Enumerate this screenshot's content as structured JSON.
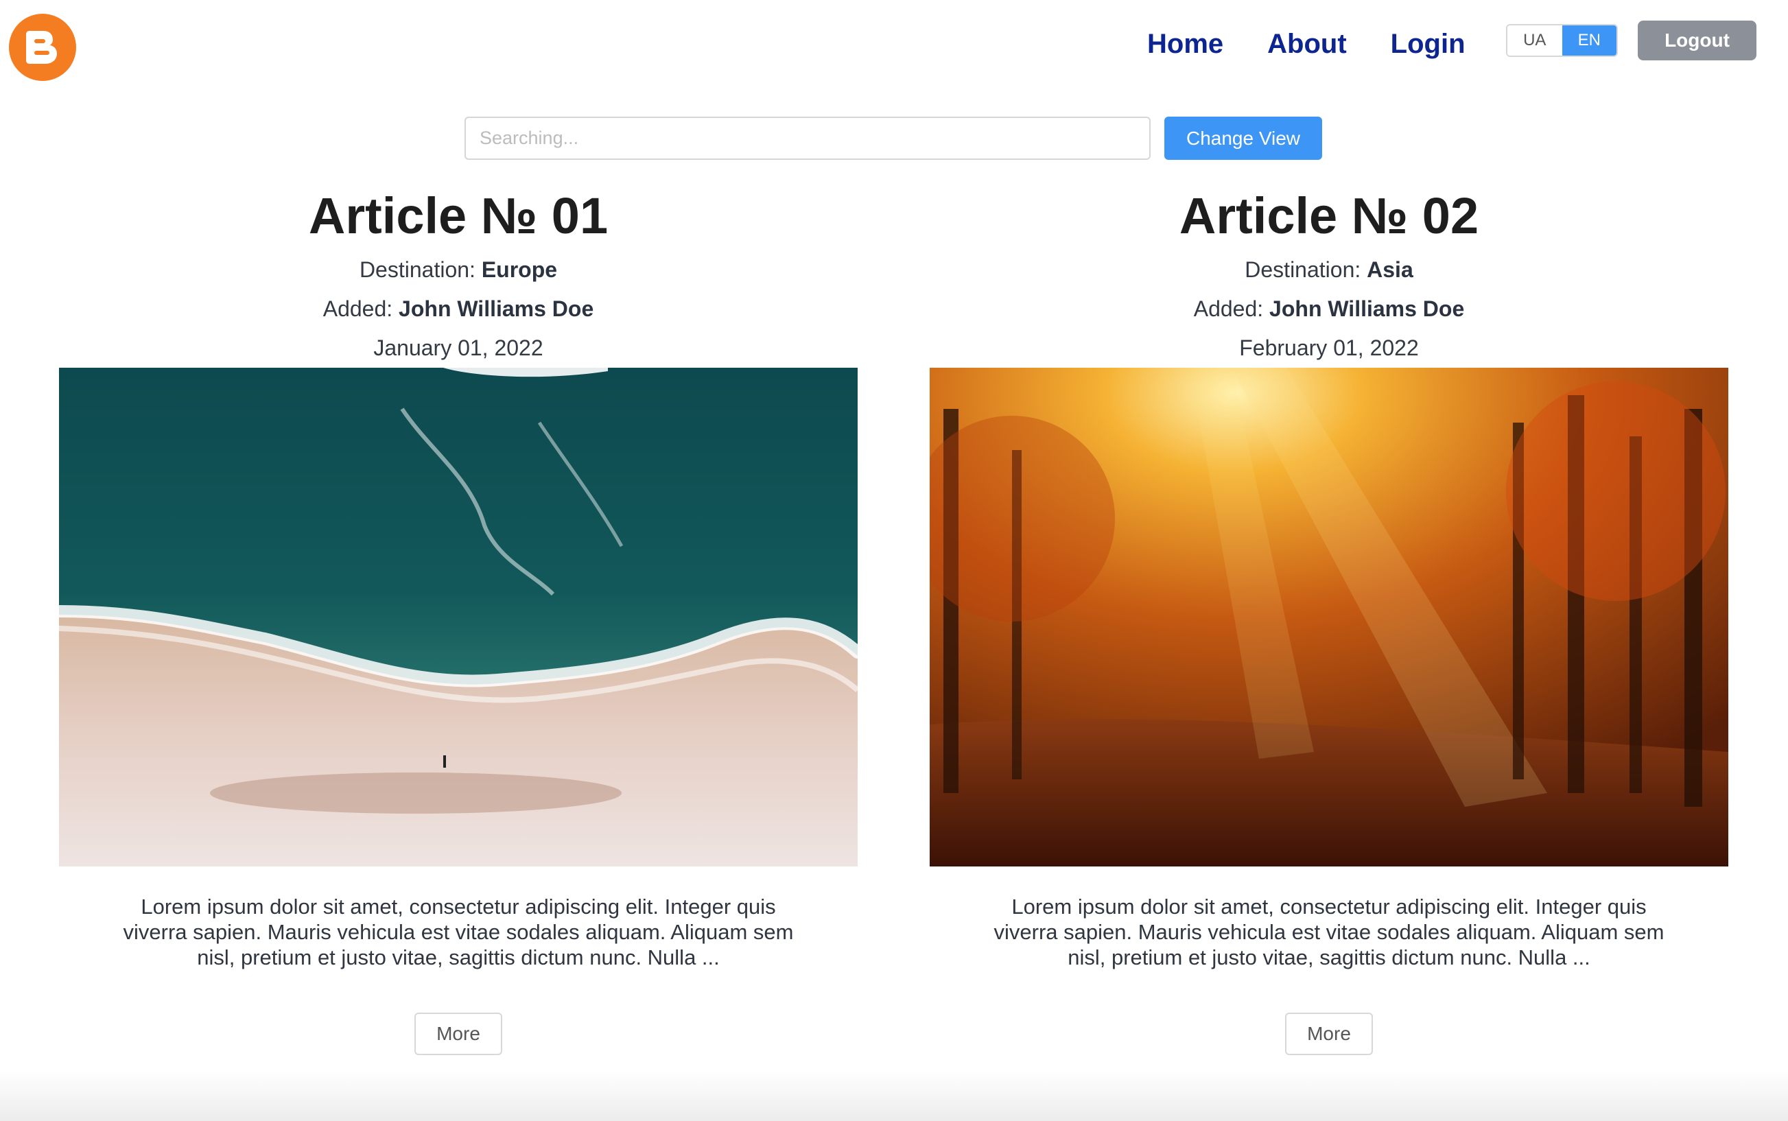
{
  "header": {
    "logo_icon": "blogger-logo-icon",
    "nav": [
      {
        "label": "Home"
      },
      {
        "label": "About"
      },
      {
        "label": "Login"
      }
    ],
    "languages": [
      {
        "label": "UA",
        "active": false
      },
      {
        "label": "EN",
        "active": true
      }
    ],
    "logout_label": "Logout"
  },
  "search": {
    "placeholder": "Searching...",
    "value": "",
    "change_view_label": "Change View"
  },
  "articles": [
    {
      "title": "Article № 01",
      "destination_label": "Destination: ",
      "destination": "Europe",
      "added_label": "Added: ",
      "author": "John Williams Doe",
      "date": "January 01, 2022",
      "image": "aerial-beach-ocean-photo",
      "excerpt": "Lorem ipsum dolor sit amet, consectetur adipiscing elit. Integer quis viverra sapien. Mauris vehicula est vitae sodales aliquam. Aliquam sem nisl, pretium et justo vitae, sagittis dictum nunc. Nulla ...",
      "more_label": "More"
    },
    {
      "title": "Article № 02",
      "destination_label": "Destination: ",
      "destination": "Asia",
      "added_label": "Added: ",
      "author": "John Williams Doe",
      "date": "February 01, 2022",
      "image": "autumn-forest-sunlight-photo",
      "excerpt": "Lorem ipsum dolor sit amet, consectetur adipiscing elit. Integer quis viverra sapien. Mauris vehicula est vitae sodales aliquam. Aliquam sem nisl, pretium et justo vitae, sagittis dictum nunc. Nulla ...",
      "more_label": "More"
    }
  ],
  "colors": {
    "logo": "#f57d21",
    "nav_link": "#0d2590",
    "accent": "#3d95f5",
    "logout": "#8c9099"
  }
}
